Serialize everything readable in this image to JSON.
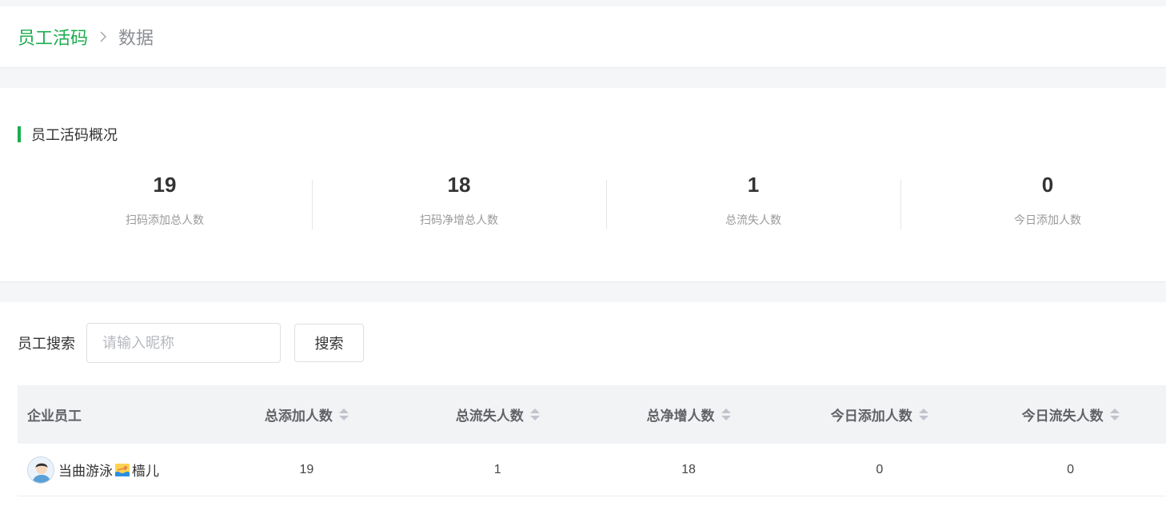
{
  "breadcrumb": {
    "root": "员工活码",
    "separator_icon": "chevron-right-icon",
    "current": "数据"
  },
  "overview": {
    "title": "员工活码概况",
    "stats": [
      {
        "value": "19",
        "label": "扫码添加总人数"
      },
      {
        "value": "18",
        "label": "扫码净增总人数"
      },
      {
        "value": "1",
        "label": "总流失人数"
      },
      {
        "value": "0",
        "label": "今日添加人数"
      }
    ]
  },
  "search": {
    "label": "员工搜索",
    "placeholder": "请输入昵称",
    "value": "",
    "button_label": "搜索"
  },
  "table": {
    "columns": [
      "企业员工",
      "总添加人数",
      "总流失人数",
      "总净增人数",
      "今日添加人数",
      "今日流失人数"
    ],
    "rows": [
      {
        "name_prefix": "当曲游泳",
        "name_suffix": "樯儿",
        "emoji_icon": "swimmer-emoji-icon",
        "total_added": "19",
        "total_lost": "1",
        "net_growth": "18",
        "today_added": "0",
        "today_lost": "0"
      }
    ]
  },
  "colors": {
    "accent": "#1aad4e",
    "header_bg": "#f2f3f5",
    "page_bg": "#f5f6f8"
  }
}
